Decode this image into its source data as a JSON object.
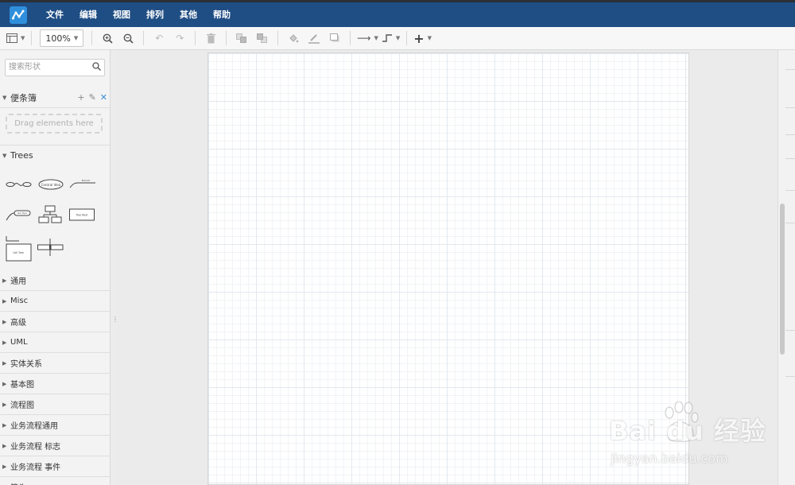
{
  "menubar": {
    "items": [
      "文件",
      "编辑",
      "视图",
      "排列",
      "其他",
      "帮助"
    ]
  },
  "toolbar": {
    "zoom": "100%"
  },
  "sidebar": {
    "search_placeholder": "搜索形状",
    "scratchpad": {
      "title": "便条簿",
      "drop_hint": "Drag elements here"
    },
    "trees": {
      "title": "Trees",
      "shapes": [
        {
          "icon": "horizontal-tree-shape"
        },
        {
          "icon": "mindmap-central-idea-shape",
          "label": "Central Idea"
        },
        {
          "icon": "branch-line-shape",
          "label": "Branch"
        },
        {
          "icon": "sub-topic-shape",
          "label": "Sub Topic"
        },
        {
          "icon": "org-tree-shape"
        },
        {
          "icon": "tree-root-box-shape",
          "label": "Tree Root"
        },
        {
          "icon": "container-tree-shape",
          "label": "Cell Tree"
        },
        {
          "icon": "horizontal-connector-boxes-shape"
        }
      ]
    },
    "collapsed_sections": [
      "通用",
      "Misc",
      "高级",
      "UML",
      "实体关系",
      "基本图",
      "流程图",
      "业务流程通用",
      "业务流程 标志",
      "业务流程 事件",
      "箭头"
    ]
  },
  "watermark": {
    "brand": "Bai du 经验",
    "url": "jingyan.baidu.com"
  },
  "colors": {
    "menubar": "#1f4e84",
    "logo": "#2f8fdc",
    "grid": "#e3e8ee"
  }
}
